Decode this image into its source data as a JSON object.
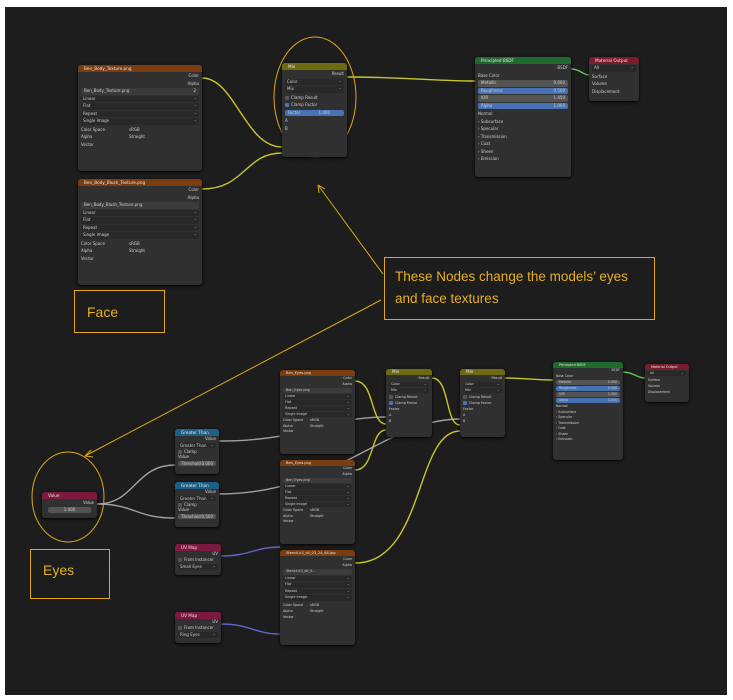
{
  "colors": {
    "texture_header": "#7a3d10",
    "mix_header": "#6e6a12",
    "bsdf_header": "#1f6b2e",
    "output_header": "#7a1c2b",
    "math_header": "#1d5f85",
    "uv_header": "#7b1a3e",
    "annotation": "#e0a818",
    "socket_yellow": "#c7c729",
    "socket_grey": "#a1a1a1",
    "socket_purple": "#6363c7",
    "socket_green": "#63c763"
  },
  "face_texture": {
    "title": "Ben_Body_Texture.png",
    "out_color": "Color",
    "out_alpha": "Alpha",
    "image_name": "Ben_Body_Texture.png",
    "image_users": "2",
    "interpolation": "Linear",
    "projection": "Flat",
    "extension": "Repeat",
    "source": "Single Image",
    "colorspace_label": "Color Space",
    "colorspace": "sRGB",
    "alpha_label": "Alpha",
    "alpha": "Straight",
    "in_vector": "Vector"
  },
  "face_blush": {
    "title": "Ben_Body_Blush_Texture.png",
    "out_color": "Color",
    "out_alpha": "Alpha",
    "image_name": "Ben_Body_Blush_Texture.png",
    "interpolation": "Linear",
    "projection": "Flat",
    "extension": "Repeat",
    "source": "Single Image",
    "colorspace_label": "Color Space",
    "colorspace": "sRGB",
    "alpha_label": "Alpha",
    "alpha": "Straight",
    "in_vector": "Vector"
  },
  "face_mix": {
    "title": "Mix",
    "out_result": "Result",
    "type": "Color",
    "blend": "Mix",
    "clamp_result": "Clamp Result",
    "clamp_factor": "Clamp Factor",
    "factor_label": "Factor",
    "factor_value": "1.000",
    "in_a": "A",
    "in_b": "B"
  },
  "face_bsdf": {
    "title": "Principled BSDF",
    "out_bsdf": "BSDF",
    "base_color": "Base Color",
    "metallic_label": "Metallic",
    "metallic": "0.000",
    "roughness_label": "Roughness",
    "roughness": "0.500",
    "ior_label": "IOR",
    "ior": "1.450",
    "alpha_label": "Alpha",
    "alpha": "1.000",
    "normal": "Normal",
    "panels": [
      "Subsurface",
      "Specular",
      "Transmission",
      "Coat",
      "Sheen",
      "Emission"
    ]
  },
  "face_output": {
    "title": "Material Output",
    "target": "All",
    "in_surface": "Surface",
    "in_volume": "Volume",
    "in_displacement": "Displacement"
  },
  "face_label": "Face",
  "eyes_label": "Eyes",
  "note": "These Nodes change the models’ eyes and face textures",
  "eyes_value": {
    "title": "Value",
    "out": "Value",
    "value": "1.000"
  },
  "eyes_math1": {
    "title": "Greater Than",
    "out": "Value",
    "op": "Greater Than",
    "clamp": "Clamp",
    "in_value": "Value",
    "threshold": "Threshold",
    "threshold_value": "0.000"
  },
  "eyes_math2": {
    "title": "Greater Than",
    "out": "Value",
    "op": "Greater Than",
    "clamp": "Clamp",
    "in_value": "Value",
    "threshold": "Threshold",
    "threshold_value": "0.500"
  },
  "eyes_uv1": {
    "title": "UV Map",
    "out": "UV",
    "from_instancer": "From Instancer",
    "map": "Small Eyes"
  },
  "eyes_uv2": {
    "title": "UV Map",
    "out": "UV",
    "from_instancer": "From Instancer",
    "map": "Ring Eyes"
  },
  "eyes_tex1": {
    "title": "Ben_Eyes.png",
    "out_color": "Color",
    "out_alpha": "Alpha",
    "image_name": "Ben_Eyes.png",
    "interpolation": "Linear",
    "projection": "Flat",
    "extension": "Repeat",
    "source": "Single Image",
    "colorspace_label": "Color Space",
    "colorspace": "sRGB",
    "alpha_label": "Alpha",
    "alpha": "Straight",
    "in_vector": "Vector"
  },
  "eyes_tex2": {
    "title": "Ben_Eyes.png",
    "out_color": "Color",
    "out_alpha": "Alpha",
    "image_name": "Ben_Eyes.png",
    "interpolation": "Linear",
    "projection": "Flat",
    "extension": "Repeat",
    "source": "Single Image",
    "colorspace_label": "Color Space",
    "colorspace": "sRGB",
    "alpha_label": "Alpha",
    "alpha": "Straight",
    "in_vector": "Vector"
  },
  "eyes_tex3": {
    "title": "Stencil.k3_dil_03_24_64.jpg",
    "out_color": "Color",
    "out_alpha": "Alpha",
    "image_name": "Stencil.k3_dil_0...",
    "interpolation": "Linear",
    "projection": "Flat",
    "extension": "Repeat",
    "source": "Single Image",
    "colorspace_label": "Color Space",
    "colorspace": "sRGB",
    "alpha_label": "Alpha",
    "alpha": "Straight",
    "in_vector": "Vector"
  },
  "eyes_mix1": {
    "title": "Mix",
    "out_result": "Result",
    "type": "Color",
    "blend": "Mix",
    "clamp_result": "Clamp Result",
    "clamp_factor": "Clamp Factor",
    "factor_label": "Factor",
    "in_a": "A",
    "in_b": "B"
  },
  "eyes_mix2": {
    "title": "Mix",
    "out_result": "Result",
    "type": "Color",
    "blend": "Mix",
    "clamp_result": "Clamp Result",
    "clamp_factor": "Clamp Factor",
    "factor_label": "Factor",
    "in_a": "A",
    "in_b": "B"
  },
  "eyes_bsdf": {
    "title": "Principled BSDF",
    "out_bsdf": "BSDF",
    "base_color": "Base Color",
    "metallic_label": "Metallic",
    "metallic": "0.000",
    "roughness_label": "Roughness",
    "roughness": "0.500",
    "ior_label": "IOR",
    "ior": "1.450",
    "alpha_label": "Alpha",
    "alpha": "1.000",
    "normal": "Normal",
    "panels": [
      "Subsurface",
      "Specular",
      "Transmission",
      "Coat",
      "Sheen",
      "Emission"
    ]
  },
  "eyes_output": {
    "title": "Material Output",
    "target": "All",
    "in_surface": "Surface",
    "in_volume": "Volume",
    "in_displacement": "Displacement"
  }
}
